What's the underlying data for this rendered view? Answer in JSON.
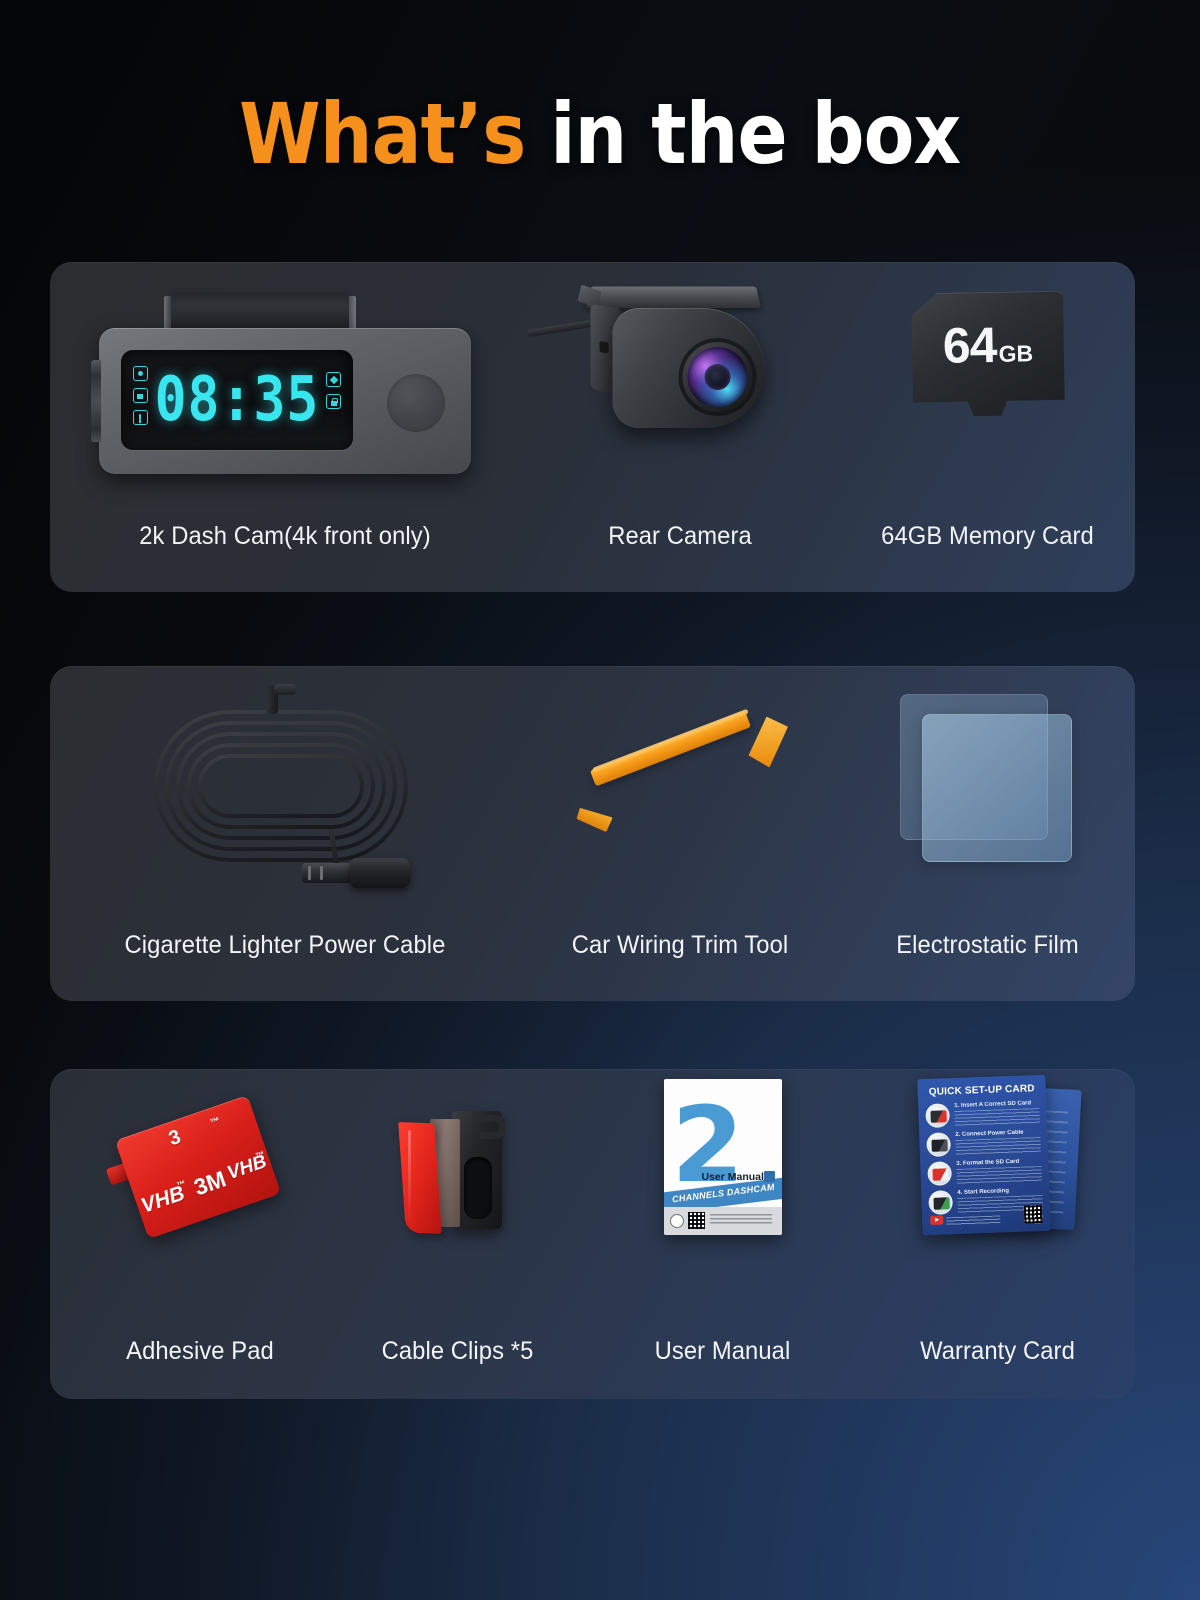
{
  "page": {
    "title_accent": "What’s",
    "title_rest": " in the box",
    "accent_color": "#f5901d",
    "text_color": "#ffffff",
    "background_dark": "#080a0c",
    "background_blue": "#1e3558"
  },
  "panels": [
    {
      "id": "panel-1",
      "items": [
        {
          "name": "dash-cam",
          "label": "2k Dash Cam(4k front only)",
          "display_time": "08:35",
          "display_color": "#38e6f0",
          "status_icons_left": [
            "record-icon",
            "sd-card-icon",
            "microphone-icon"
          ],
          "status_icons_right": [
            "gps-icon",
            "lock-icon"
          ]
        },
        {
          "name": "rear-camera",
          "label": "Rear Camera"
        },
        {
          "name": "memory-card",
          "label": "64GB Memory Card",
          "capacity_number": "64",
          "capacity_unit": "GB"
        }
      ]
    },
    {
      "id": "panel-2",
      "items": [
        {
          "name": "power-cable",
          "label": "Cigarette Lighter Power Cable"
        },
        {
          "name": "trim-tool",
          "label": "Car Wiring Trim Tool",
          "color": "#f5a01a"
        },
        {
          "name": "electrostatic-film",
          "label": "Electrostatic Film"
        }
      ]
    },
    {
      "id": "panel-3",
      "items": [
        {
          "name": "adhesive-pad",
          "label": "Adhesive Pad",
          "brand_marks": [
            "VHB",
            "3M",
            "VHB",
            "3",
            "™",
            "™",
            "™"
          ]
        },
        {
          "name": "cable-clips",
          "label": "Cable Clips *5"
        },
        {
          "name": "user-manual",
          "label": "User Manual",
          "cover_number": "2",
          "cover_title": "User Manual",
          "cover_banner": "CHANNELS DASHCAM"
        },
        {
          "name": "warranty-card",
          "label": "Warranty Card",
          "card_title": "QUICK SET-UP CARD",
          "steps": [
            "1. Insert A Correct SD Card",
            "2. Connect Power Cable",
            "3. Format the SD Card",
            "4. Start Recording"
          ]
        }
      ]
    }
  ]
}
